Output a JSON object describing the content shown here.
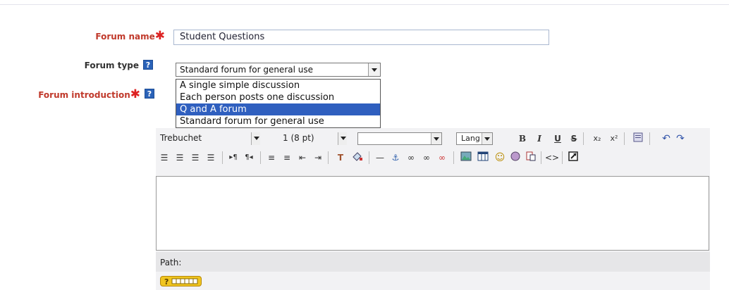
{
  "form": {
    "forum_name_label": "Forum name",
    "forum_name_value": "Student Questions",
    "forum_type_label": "Forum type",
    "forum_type_selected": "Standard forum for general use",
    "forum_type_options": [
      "A single simple discussion",
      "Each person posts one discussion",
      "Q and A forum",
      "Standard forum for general use"
    ],
    "forum_type_highlighted": "Q and A forum",
    "forum_intro_label": "Forum introduction",
    "required_mark": "✱",
    "help_icon": "?"
  },
  "editor": {
    "font_family": "Trebuchet",
    "font_size": "1 (8 pt)",
    "style_select": "",
    "lang_select": "Lang",
    "path_label": "Path:"
  },
  "colors": {
    "required_label": "#c0392b",
    "help_icon_bg": "#2a62b8",
    "dropdown_highlight": "#2f5fbf"
  }
}
